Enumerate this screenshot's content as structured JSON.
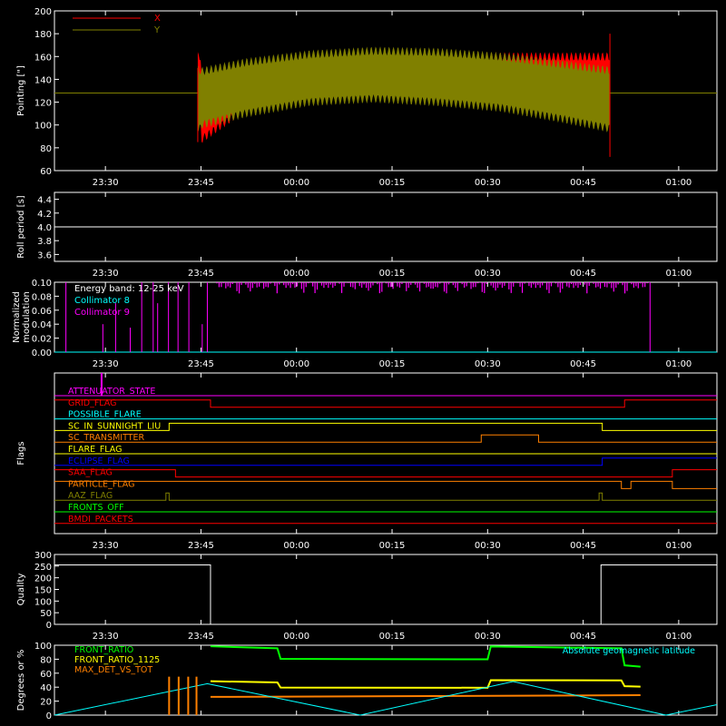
{
  "time_axis": {
    "range": [
      "23:22",
      "01:06"
    ],
    "tick_labels": [
      "23:30",
      "23:45",
      "00:00",
      "00:15",
      "00:30",
      "00:45",
      "01:00"
    ],
    "tick_minutes": [
      8,
      23,
      38,
      53,
      68,
      83,
      98
    ]
  },
  "chart_data": [
    {
      "type": "area",
      "ylabel": "Pointing [\"]",
      "ylim": [
        60,
        200
      ],
      "y_ticks": [
        60,
        80,
        100,
        120,
        140,
        160,
        180,
        200
      ],
      "legend": "top-left",
      "series": [
        {
          "name": "X",
          "color": "#ff0000",
          "x_range": [
            22.5,
            87.2
          ],
          "envelope": {
            "x": [
              23,
              30,
              40,
              50,
              60,
              70,
              80,
              87
            ],
            "low": [
              87,
              115,
              122,
              125,
              122,
              118,
              110,
              100
            ],
            "high": [
              140,
              148,
              153,
              157,
              160,
              160,
              160,
              160
            ]
          }
        },
        {
          "name": "Y",
          "color": "#808000",
          "x_range": [
            22.5,
            87.2
          ],
          "envelope": {
            "x": [
              23,
              30,
              40,
              50,
              60,
              70,
              80,
              87
            ],
            "low": [
              100,
              110,
              120,
              123,
              120,
              115,
              105,
              97
            ],
            "high": [
              147,
              155,
              162,
              165,
              164,
              160,
              153,
              148
            ]
          },
          "baseline": 128
        }
      ]
    },
    {
      "type": "line",
      "ylabel": "Roll period [s]",
      "ylim": [
        3.5,
        4.5
      ],
      "y_ticks": [
        3.6,
        3.8,
        4.0,
        4.2,
        4.4
      ],
      "y_tick_labels": [
        "3.6",
        "3.8",
        "4.0",
        "4.2",
        "4.4"
      ],
      "series": [
        {
          "name": "",
          "color": "#ffffff",
          "value": 4.0
        }
      ]
    },
    {
      "type": "line",
      "ylabel": "Normalized modulation",
      "ylim": [
        0,
        0.1
      ],
      "y_ticks": [
        0,
        0.02,
        0.04,
        0.06,
        0.08,
        0.1
      ],
      "y_tick_labels": [
        "0.00",
        "0.02",
        "0.04",
        "0.06",
        "0.08",
        "0.10"
      ],
      "annotation": "Energy band: 12-25 keV",
      "legend": "top-left",
      "series": [
        {
          "name": "Collimator 8",
          "color": "#00ffff",
          "value": 0.0
        },
        {
          "name": "Collimator 9",
          "color": "#ff00ff",
          "active_range": [
            25.5,
            93.5
          ],
          "spikes": [
            [
              1.8,
              0.1
            ],
            [
              7.6,
              0.04
            ],
            [
              9.6,
              0.07
            ],
            [
              11.9,
              0.035
            ],
            [
              13.7,
              0.1
            ],
            [
              15.5,
              0.1
            ],
            [
              16.2,
              0.07
            ],
            [
              17.9,
              0.1
            ],
            [
              19.4,
              0.1
            ],
            [
              21.1,
              0.1
            ],
            [
              23.2,
              0.04
            ],
            [
              24.0,
              0.1
            ]
          ]
        }
      ]
    },
    {
      "type": "line",
      "ylabel": "Flags",
      "series": [
        {
          "name": "ATTENUATOR_STATE",
          "color": "#ff00ff",
          "segments": [
            [
              0,
              104,
              0
            ]
          ],
          "spikes": [
            7.4
          ]
        },
        {
          "name": "GRID_FLAG",
          "color": "#ff0000",
          "segments": [
            [
              0,
              24.5,
              1
            ],
            [
              24.5,
              89.5,
              0
            ],
            [
              89.5,
              104,
              1
            ]
          ]
        },
        {
          "name": "POSSIBLE_FLARE",
          "color": "#00ffff",
          "segments": [
            [
              0,
              104,
              0
            ]
          ]
        },
        {
          "name": "SC_IN_SUNNIGHT_LIU",
          "color": "#ffff00",
          "segments": [
            [
              0,
              18,
              0
            ],
            [
              18,
              86,
              1
            ],
            [
              86,
              104,
              0
            ]
          ]
        },
        {
          "name": "SC_TRANSMITTER",
          "color": "#ff8000",
          "segments": [
            [
              0,
              67,
              0
            ],
            [
              67,
              76,
              1
            ],
            [
              76,
              104,
              0
            ]
          ]
        },
        {
          "name": "FLARE_FLAG",
          "color": "#ffff00",
          "segments": [
            [
              0,
              104,
              0
            ]
          ]
        },
        {
          "name": "ECLIPSE_FLAG",
          "color": "#0000ff",
          "segments": [
            [
              0,
              86,
              0
            ],
            [
              86,
              104,
              1
            ]
          ]
        },
        {
          "name": "SAA_FLAG",
          "color": "#ff0000",
          "segments": [
            [
              0,
              19,
              1
            ],
            [
              19,
              97,
              0
            ],
            [
              97,
              104,
              1
            ]
          ]
        },
        {
          "name": "PARTICLE_FLAG",
          "color": "#ff8000",
          "segments": [
            [
              0,
              89,
              1
            ],
            [
              89,
              90.5,
              0
            ],
            [
              90.5,
              97,
              1
            ],
            [
              97,
              104,
              0
            ]
          ]
        },
        {
          "name": "AAZ_FLAG",
          "color": "#808000",
          "segments": [
            [
              0,
              17.5,
              0
            ],
            [
              17.5,
              18,
              1
            ],
            [
              18,
              85.5,
              0
            ],
            [
              85.5,
              86,
              1
            ],
            [
              86,
              104,
              0
            ]
          ]
        },
        {
          "name": "FRONTS_OFF",
          "color": "#00ff00",
          "segments": [
            [
              0,
              104,
              0
            ]
          ]
        },
        {
          "name": "BMDI_PACKETS",
          "color": "#ff0000",
          "segments": [
            [
              0,
              104,
              0
            ]
          ]
        }
      ]
    },
    {
      "type": "line",
      "ylabel": "Quality",
      "ylim": [
        0,
        300
      ],
      "y_ticks": [
        0,
        50,
        100,
        150,
        200,
        250,
        300
      ],
      "series": [
        {
          "name": "",
          "color": "#ffffff",
          "segments": [
            [
              0,
              24.5,
              255
            ],
            [
              24.5,
              85.8,
              0
            ],
            [
              85.8,
              104,
              255
            ]
          ]
        }
      ]
    },
    {
      "type": "line",
      "ylabel": "Degrees or %",
      "ylim": [
        0,
        100
      ],
      "y_ticks": [
        0,
        20,
        40,
        60,
        80,
        100
      ],
      "legend": "top-left",
      "series": [
        {
          "name": "FRONT_RATIO",
          "color": "#00ff00",
          "points": [
            [
              24.5,
              97
            ],
            [
              35,
              97
            ],
            [
              35.5,
              80
            ],
            [
              68,
              80
            ],
            [
              68.5,
              97
            ],
            [
              89,
              97
            ],
            [
              89.5,
              70
            ],
            [
              92,
              70
            ]
          ]
        },
        {
          "name": "FRONT_RATIO_1125",
          "color": "#ffff00",
          "points": [
            [
              24.5,
              48
            ],
            [
              35,
              48
            ],
            [
              35.5,
              38
            ],
            [
              68,
              38
            ],
            [
              68.5,
              50
            ],
            [
              89,
              50
            ],
            [
              89.5,
              40
            ],
            [
              92,
              40
            ]
          ]
        },
        {
          "name": "MAX_DET_VS_TOT",
          "color": "#ff8000",
          "points": [
            [
              24.5,
              27
            ],
            [
              92,
              27
            ]
          ]
        },
        {
          "name": "Absolute geomagnetic latitude",
          "color": "#00ffff",
          "points": [
            [
              0,
              0
            ],
            [
              24,
              45
            ],
            [
              48,
              0
            ],
            [
              72,
              48
            ],
            [
              96,
              0
            ],
            [
              104,
              15
            ]
          ]
        }
      ]
    }
  ]
}
